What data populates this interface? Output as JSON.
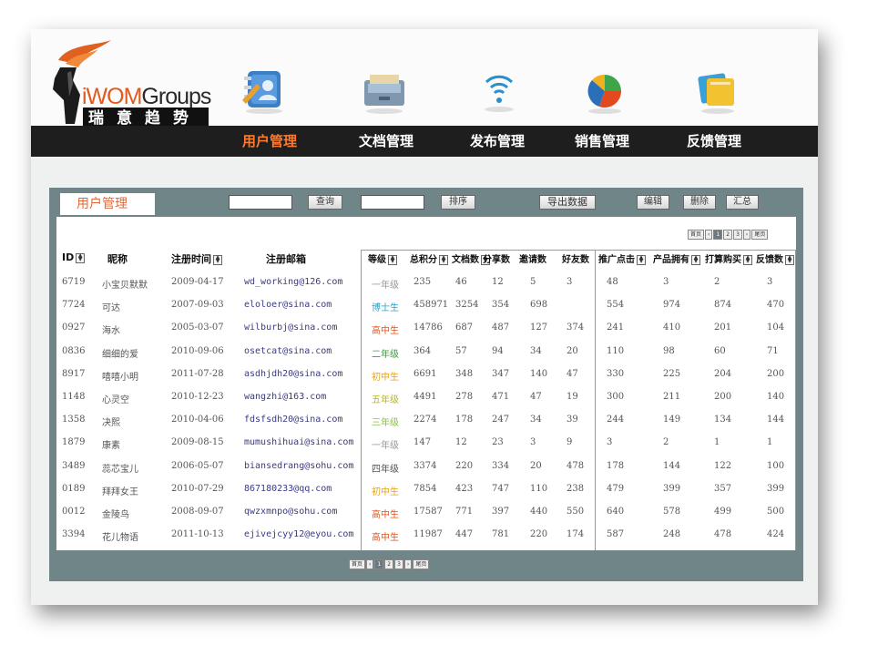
{
  "logo": {
    "brand_prefix": "iWOM",
    "brand_suffix": "Groups",
    "chinese": "瑞意趋势"
  },
  "icons": [
    "contacts-icon",
    "document-drawer-icon",
    "broadcast-icon",
    "pie-chart-icon",
    "feedback-cards-icon"
  ],
  "nav": [
    "用户管理",
    "文档管理",
    "发布管理",
    "销售管理",
    "反馈管理"
  ],
  "panel": {
    "title": "用户管理",
    "query_btn": "查询",
    "sort_btn": "排序",
    "export_btn": "导出数据",
    "edit_btn": "编辑",
    "delete_btn": "删除",
    "summary_btn": "汇总"
  },
  "pager": {
    "first": "首页",
    "prev": "‹",
    "pages": [
      "1",
      "2",
      "3"
    ],
    "current": "1",
    "next": "›",
    "last": "尾页"
  },
  "headers": {
    "id": "ID",
    "nick": "昵称",
    "date": "注册时间",
    "email": "注册邮箱",
    "level": "等级",
    "points": "总积分",
    "docs": "文档数",
    "shares": "分享数",
    "invites": "邀请数",
    "friends": "好友数",
    "clicks": "推广点击",
    "products": "产品拥有",
    "plan": "打算购买",
    "feedback": "反馈数"
  },
  "level_colors": {
    "一年级": "#9a9a9a",
    "博士生": "#2aa3c9",
    "高中生": "#e0551c",
    "二年级": "#3aa03a",
    "初中生": "#e8a21c",
    "五年级": "#b8b81a",
    "三年级": "#8cc24a",
    "四年级": "#555555"
  },
  "rows": [
    {
      "id": "6719",
      "nick": "小宝贝默默",
      "date": "2009-04-17",
      "email": "wd_working@126.com",
      "level": "一年级",
      "points": "235",
      "docs": "46",
      "shares": "12",
      "invites": "5",
      "friends": "3",
      "clicks": "48",
      "products": "3",
      "plan": "2",
      "feedback": "3"
    },
    {
      "id": "7724",
      "nick": "可达",
      "date": "2007-09-03",
      "email": "eloloer@sina.com",
      "level": "博士生",
      "points": "458971",
      "docs": "3254",
      "shares": "354",
      "invites": "698",
      "friends": "",
      "clicks": "554",
      "products": "974",
      "plan": "874",
      "feedback": "470"
    },
    {
      "id": "0927",
      "nick": "海水",
      "date": "2005-03-07",
      "email": "wilburbj@sina.com",
      "level": "高中生",
      "points": "14786",
      "docs": "687",
      "shares": "487",
      "invites": "127",
      "friends": "374",
      "clicks": "241",
      "products": "410",
      "plan": "201",
      "feedback": "104"
    },
    {
      "id": "0836",
      "nick": "细细的爱",
      "date": "2010-09-06",
      "email": "osetcat@sina.com",
      "level": "二年级",
      "points": "364",
      "docs": "57",
      "shares": "94",
      "invites": "34",
      "friends": "20",
      "clicks": "110",
      "products": "98",
      "plan": "60",
      "feedback": "71"
    },
    {
      "id": "8917",
      "nick": "嘻嘻小明",
      "date": "2011-07-28",
      "email": "asdhjdh20@sina.com",
      "level": "初中生",
      "points": "6691",
      "docs": "348",
      "shares": "347",
      "invites": "140",
      "friends": "47",
      "clicks": "330",
      "products": "225",
      "plan": "204",
      "feedback": "200"
    },
    {
      "id": "1148",
      "nick": "心灵空",
      "date": "2010-12-23",
      "email": "wangzhi@163.com",
      "level": "五年级",
      "points": "4491",
      "docs": "278",
      "shares": "471",
      "invites": "47",
      "friends": "19",
      "clicks": "300",
      "products": "211",
      "plan": "200",
      "feedback": "140"
    },
    {
      "id": "1358",
      "nick": "决熙",
      "date": "2010-04-06",
      "email": "fdsfsdh20@sina.com",
      "level": "三年级",
      "points": "2274",
      "docs": "178",
      "shares": "247",
      "invites": "34",
      "friends": "39",
      "clicks": "244",
      "products": "149",
      "plan": "134",
      "feedback": "144"
    },
    {
      "id": "1879",
      "nick": "康素",
      "date": "2009-08-15",
      "email": "mumushihuai@sina.com",
      "level": "一年级",
      "points": "147",
      "docs": "12",
      "shares": "23",
      "invites": "3",
      "friends": "9",
      "clicks": "3",
      "products": "2",
      "plan": "1",
      "feedback": "1"
    },
    {
      "id": "3489",
      "nick": "蕊芯宝儿",
      "date": "2006-05-07",
      "email": "biansedrang@sohu.com",
      "level": "四年级",
      "points": "3374",
      "docs": "220",
      "shares": "334",
      "invites": "20",
      "friends": "478",
      "clicks": "178",
      "products": "144",
      "plan": "122",
      "feedback": "100"
    },
    {
      "id": "0189",
      "nick": "拜拜女王",
      "date": "2010-07-29",
      "email": "867180233@qq.com",
      "level": "初中生",
      "points": "7854",
      "docs": "423",
      "shares": "747",
      "invites": "110",
      "friends": "238",
      "clicks": "479",
      "products": "399",
      "plan": "357",
      "feedback": "399"
    },
    {
      "id": "0012",
      "nick": "金陵鸟",
      "date": "2008-09-07",
      "email": "qwzxmnpo@sohu.com",
      "level": "高中生",
      "points": "17587",
      "docs": "771",
      "shares": "397",
      "invites": "440",
      "friends": "550",
      "clicks": "640",
      "products": "578",
      "plan": "499",
      "feedback": "500"
    },
    {
      "id": "3394",
      "nick": "花儿物语",
      "date": "2011-10-13",
      "email": "ejivejcyy12@eyou.com",
      "level": "高中生",
      "points": "11987",
      "docs": "447",
      "shares": "781",
      "invites": "220",
      "friends": "174",
      "clicks": "587",
      "products": "248",
      "plan": "478",
      "feedback": "424"
    }
  ]
}
